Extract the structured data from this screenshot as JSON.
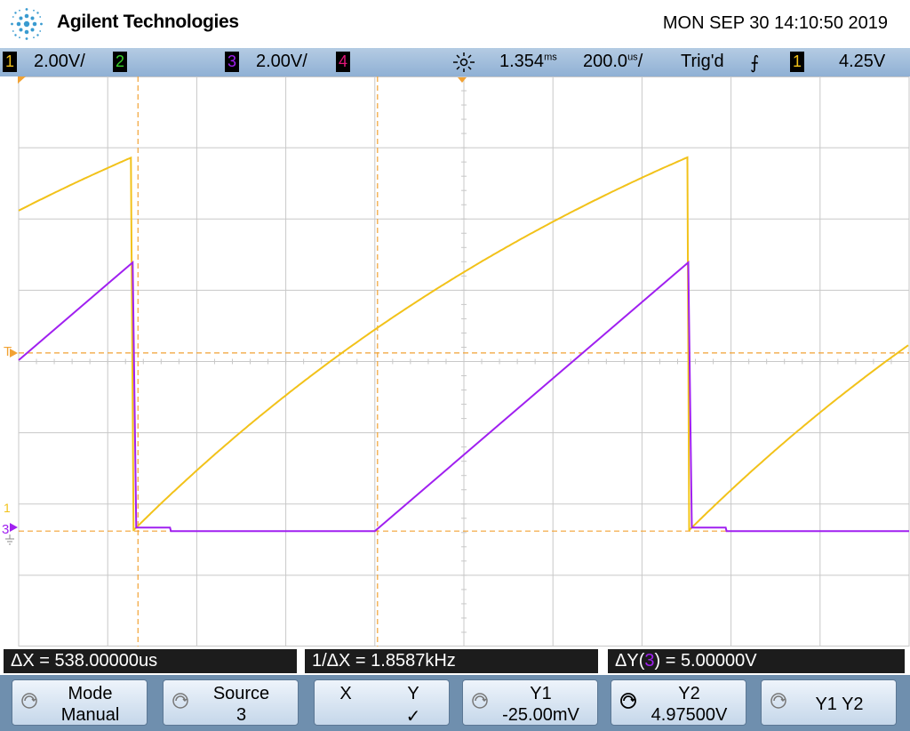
{
  "header": {
    "brand": "Agilent Technologies",
    "datetime": "MON SEP 30 14:10:50 2019"
  },
  "status": {
    "ch1_num": "1",
    "ch1_scale": "2.00V/",
    "ch2_num": "2",
    "ch3_num": "3",
    "ch3_scale": "2.00V/",
    "ch4_num": "4",
    "delay_value": "1.354",
    "delay_unit": "m s",
    "timebase_value": "200.0",
    "timebase_unit": "u s",
    "timebase_suffix": "/",
    "trigger_state": "Trig'd",
    "trigger_slope_symbol": "⨍",
    "trigger_source": "1",
    "trigger_level": "4.25V"
  },
  "markers": {
    "trigger": "T",
    "ch1": "1",
    "ch3": "3"
  },
  "colors": {
    "ch1": "#f2c21a",
    "ch2": "#3ad12a",
    "ch3": "#a020f0",
    "ch4": "#e0167a",
    "cursor": "#f2a233",
    "grid": "#c8c8c8"
  },
  "readouts": {
    "delta_x": "ΔX = 538.00000us",
    "inv_delta_x": "1/ΔX = 1.8587kHz",
    "delta_y_prefix": "ΔY(",
    "delta_y_channel": "3",
    "delta_y_suffix": ") = 5.00000V"
  },
  "softkeys": [
    {
      "line1": "Mode",
      "line2": "Manual"
    },
    {
      "line1": "Source",
      "line2": "3"
    },
    {
      "line1_a": "X",
      "line1_b": "Y",
      "line2": "✓"
    },
    {
      "line1": "Y1",
      "line2": "-25.00mV"
    },
    {
      "line1": "Y2",
      "line2": "4.97500V"
    },
    {
      "line1": "Y1 Y2",
      "line2": ""
    }
  ],
  "trace_data": {
    "time_per_div_us": 200,
    "ch1_volts_per_div": 2,
    "ch3_volts_per_div": 2,
    "ch1_ground_div": -2.38,
    "ch3_ground_div": -2.38,
    "ch1": {
      "period_divs": 6.24,
      "reset_time_div": 1.28,
      "min_div": -2.38,
      "max_div": 2.87
    },
    "ch3": {
      "reset_time_div": 1.28,
      "ramp_start_div": 4.0,
      "ramp_end_div": 7.52,
      "max_div": 1.39,
      "baseline_div": -2.38
    },
    "cursors": {
      "x1_div": 1.34,
      "x2_div": 4.03,
      "y1_div": -2.38,
      "y2_div": 0.12
    }
  }
}
